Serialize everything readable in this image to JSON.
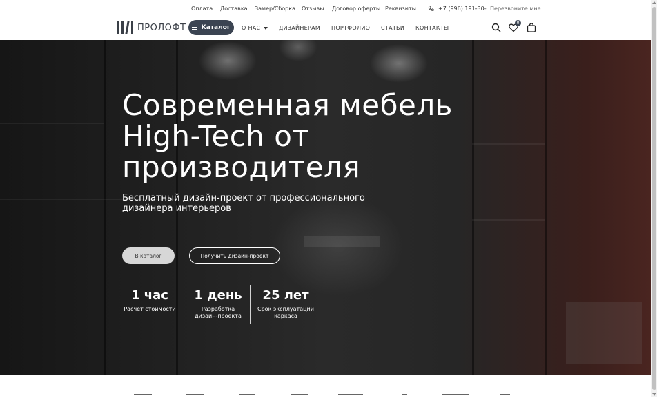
{
  "topbar": {
    "links": [
      "Оплата",
      "Доставка",
      "Замер/Сборка",
      "Отзывы",
      "Договор оферты",
      "Реквизиты"
    ],
    "phone": "+7 (996) 191-30-",
    "callback": "Перезвоните мне"
  },
  "header": {
    "logo_text": "ПРОЛОФТ",
    "catalog_label": "Каталог",
    "nav": [
      "О НАС",
      "ДИЗАЙНЕРАМ",
      "ПОРТФОЛИО",
      "СТАТЬИ",
      "КОНТАКТЫ"
    ],
    "favorites_count": "0"
  },
  "hero": {
    "title": "Современная мебель High-Tech от производителя",
    "subtitle": "Бесплатный дизайн-проект от профессионального дизайнера интерьеров",
    "btn_catalog": "В каталог",
    "btn_project": "Получить дизайн-проект",
    "stats": [
      {
        "num": "1 час",
        "label": "Расчет стоимости"
      },
      {
        "num": "1 день",
        "label": "Разработка дизайн-проекта"
      },
      {
        "num": "25 лет",
        "label": "Срок эксплуатации каркаса"
      }
    ]
  },
  "icons": {
    "phone": "phone-icon",
    "search": "search-icon",
    "favorites": "heart-icon",
    "cart": "bag-icon",
    "menu": "burger-icon"
  }
}
